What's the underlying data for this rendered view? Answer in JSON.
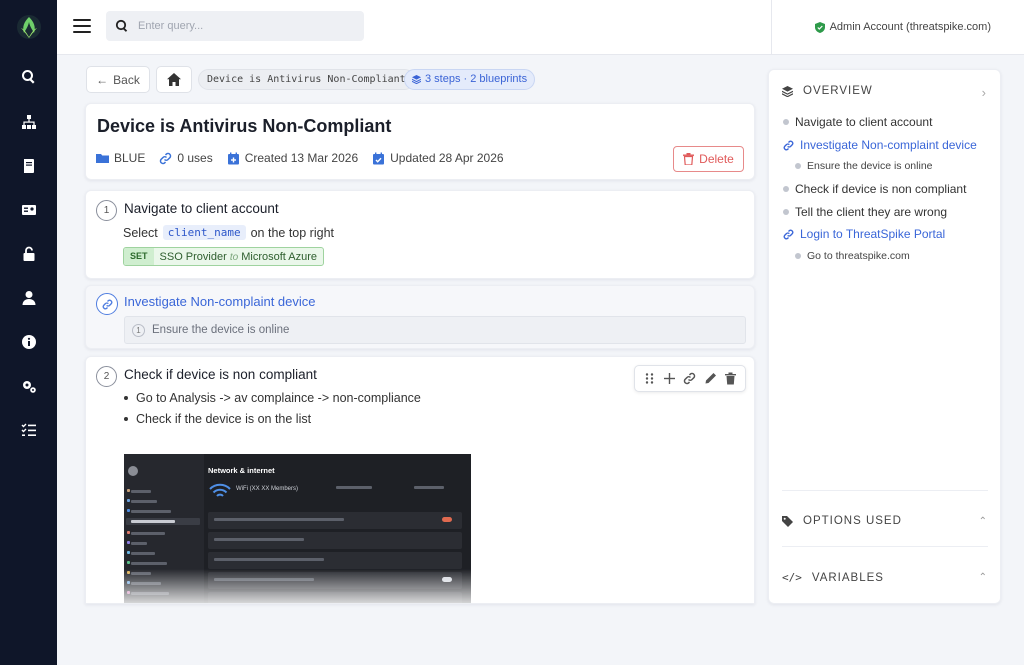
{
  "header": {
    "search_placeholder": "Enter query...",
    "account_label": "Admin Account (threatspike.com)"
  },
  "breadcrumb": {
    "back_label": "Back",
    "current": "Device is Antivirus Non-Compliant",
    "steps_badge": "3 steps · 2 blueprints"
  },
  "runbook": {
    "title": "Device is Antivirus Non-Compliant",
    "folder": "BLUE",
    "uses": "0 uses",
    "created": "Created 13 Mar 2026",
    "updated": "Updated 28 Apr 2026",
    "delete_label": "Delete"
  },
  "steps": [
    {
      "number": "1",
      "title": "Navigate to client account",
      "select_prefix": "Select",
      "variable": "client_name",
      "select_suffix": "on the top right",
      "set_label": "SET",
      "set_key": "SSO Provider",
      "set_to": "to",
      "set_value": "Microsoft Azure"
    },
    {
      "title": "Investigate Non-complaint device",
      "sub_number": "1",
      "sub_title": "Ensure the device is online"
    },
    {
      "number": "2",
      "title": "Check if device is non compliant",
      "bullets": [
        "Go to Analysis -> av complaince -> non-compliance",
        "Check if the device is on the list"
      ]
    }
  ],
  "screenshot": {
    "heading": "Network & internet",
    "wifi_label": "WiFi (XX XX Members)"
  },
  "overview": {
    "heading": "OVERVIEW",
    "items": [
      "Navigate to client account",
      "Investigate Non-complaint device",
      "Ensure the device is online",
      "Check if device is non compliant",
      "Tell the client they are wrong",
      "Login to ThreatSpike Portal",
      "Go to threatspike.com"
    ],
    "options_heading": "OPTIONS USED",
    "variables_heading": "VARIABLES"
  },
  "colors": {
    "sidebar": "#0f1629",
    "accent": "#3a66d8",
    "danger": "#e05a5a",
    "success": "#2e9a4a"
  }
}
